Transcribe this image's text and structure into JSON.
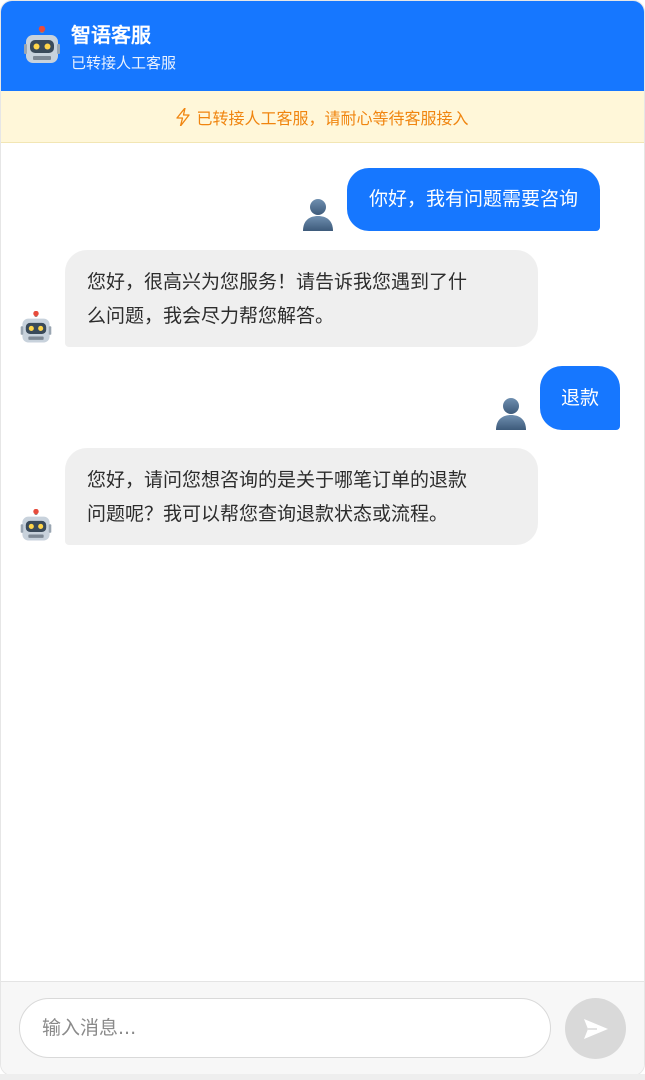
{
  "header": {
    "title": "智语客服",
    "subtitle": "已转接人工客服",
    "avatar_icon": "robot-icon",
    "background_color": "#1677ff"
  },
  "notice": {
    "icon": "lightning-bolt-icon",
    "text": "已转接人工客服，请耐心等待客服接入",
    "color": "#f0850f",
    "background_color": "#fff7d9"
  },
  "messages": [
    {
      "role": "user",
      "avatar_icon": "person-icon",
      "text": "你好，我有问题需要咨询"
    },
    {
      "role": "bot",
      "avatar_icon": "robot-icon",
      "lines": [
        "您好，很高兴为您服务！请告诉我您遇到了什",
        "么问题，我会尽力帮您解答。"
      ]
    },
    {
      "role": "user",
      "avatar_icon": "person-icon",
      "text": "退款"
    },
    {
      "role": "bot",
      "avatar_icon": "robot-icon",
      "lines": [
        "您好，请问您想咨询的是关于哪笔订单的退款",
        "问题呢？我可以帮您查询退款状态或流程。"
      ]
    }
  ],
  "composer": {
    "placeholder": "输入消息...",
    "value": "",
    "send_icon": "send-arrow-icon"
  }
}
